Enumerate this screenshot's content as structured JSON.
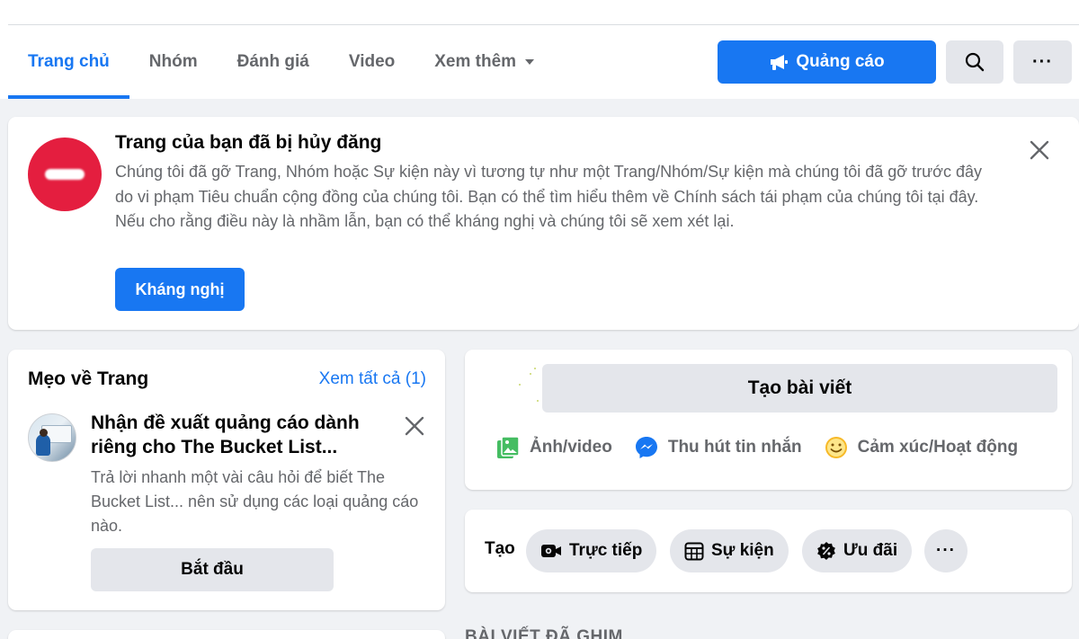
{
  "nav": {
    "tabs": [
      {
        "label": "Trang chủ",
        "active": true
      },
      {
        "label": "Nhóm"
      },
      {
        "label": "Đánh giá"
      },
      {
        "label": "Video"
      },
      {
        "label": "Xem thêm"
      }
    ],
    "ads_button_label": "Quảng cáo",
    "more_button_label": "···"
  },
  "alert": {
    "title": "Trang của bạn đã bị hủy đăng",
    "body": "Chúng tôi đã gỡ Trang, Nhóm hoặc Sự kiện này vì tương tự như một Trang/Nhóm/Sự kiện mà chúng tôi đã gỡ trước đây do vi phạm Tiêu chuẩn cộng đồng của chúng tôi. Bạn có thể tìm hiểu thêm về Chính sách tái phạm của chúng tôi tại đây. Nếu cho rằng điều này là nhầm lẫn, bạn có thể kháng nghị và chúng tôi sẽ xem xét lại.",
    "appeal_button_label": "Kháng nghị"
  },
  "tips": {
    "title": "Mẹo về Trang",
    "see_all": "Xem tất cả (1)",
    "item": {
      "heading": "Nhận đề xuất quảng cáo dành riêng cho The Bucket List...",
      "description": "Trả lời nhanh một vài câu hỏi để biết The Bucket List... nên sử dụng các loại quảng cáo nào.",
      "start_button_label": "Bắt đầu"
    }
  },
  "create_post": {
    "input_label": "Tạo bài viết",
    "actions": [
      {
        "label": "Ảnh/video",
        "icon": "photo-video-icon"
      },
      {
        "label": "Thu hút tin nhắn",
        "icon": "messenger-icon"
      },
      {
        "label": "Cảm xúc/Hoạt động",
        "icon": "smile-icon"
      }
    ]
  },
  "quick_create": {
    "label": "Tạo",
    "chips": [
      {
        "label": "Trực tiếp",
        "icon": "live-video-icon"
      },
      {
        "label": "Sự kiện",
        "icon": "calendar-icon"
      },
      {
        "label": "Ưu đãi",
        "icon": "offer-icon"
      }
    ],
    "more_label": "···"
  },
  "pinned": {
    "label": "BÀI VIẾT ĐÃ GHIM"
  },
  "colors": {
    "accent": "#1877f2",
    "danger": "#e41e3f",
    "background": "#f0f2f5",
    "secondary_text": "#65676b"
  }
}
